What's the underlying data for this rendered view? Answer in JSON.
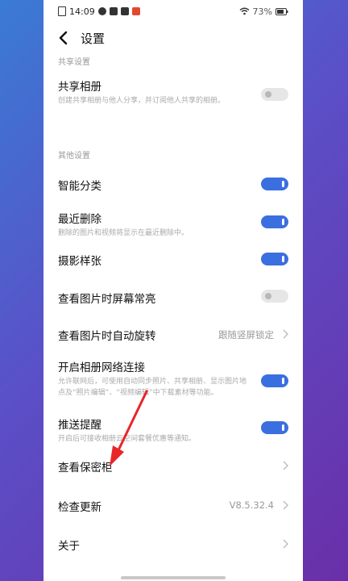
{
  "status": {
    "time": "14:09",
    "battery": "73%"
  },
  "header": {
    "title": "设置"
  },
  "sections": {
    "share_label": "共享设置",
    "other_label": "其他设置"
  },
  "rows": {
    "share_album": {
      "title": "共享相册",
      "desc": "创建共享相册与他人分享，并订阅他人共享的相册。",
      "on": false
    },
    "smart_classify": {
      "title": "智能分类",
      "on": true
    },
    "recently_deleted": {
      "title": "最近删除",
      "desc": "删除的图片和视频将显示在最近删除中。",
      "on": true
    },
    "photo_sample": {
      "title": "摄影样张",
      "on": true
    },
    "screen_on": {
      "title": "查看图片时屏幕常亮",
      "on": false
    },
    "auto_rotate": {
      "title": "查看图片时自动旋转",
      "value": "跟随竖屏锁定"
    },
    "network": {
      "title": "开启相册网络连接",
      "desc": "允许联网后，可使用自动同步照片、共享相册、显示图片地点及“照片编辑”、“视频编辑”中下载素材等功能。",
      "on": true
    },
    "push": {
      "title": "推送提醒",
      "desc": "开启后可接收相册云空间套餐优惠等通知。",
      "on": true
    },
    "vault": {
      "title": "查看保密柜"
    },
    "update": {
      "title": "检查更新",
      "value": "V8.5.32.4"
    },
    "about": {
      "title": "关于"
    }
  },
  "colors": {
    "accent": "#3b6fe0",
    "arrow": "#e8262a"
  }
}
